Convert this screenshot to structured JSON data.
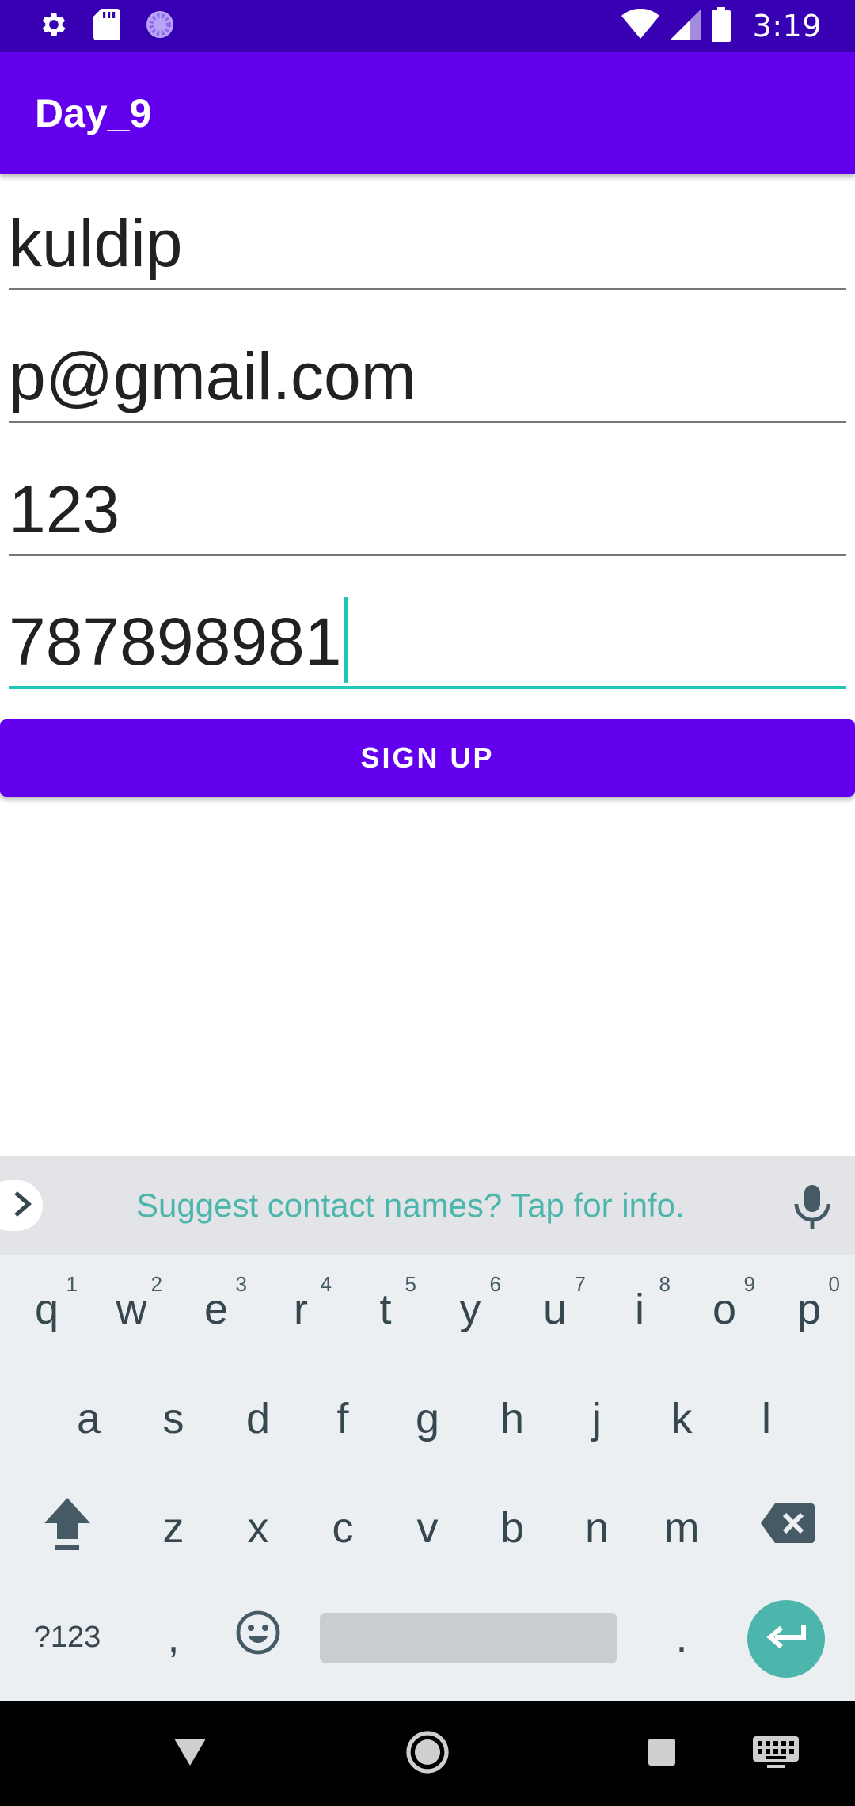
{
  "status_bar": {
    "time": "3:19",
    "left_icons": [
      "gear-icon",
      "sd-card-icon",
      "sync-icon"
    ],
    "right_icons": [
      "wifi-icon",
      "cell-signal-icon",
      "battery-icon"
    ]
  },
  "app_bar": {
    "title": "Day_9"
  },
  "form": {
    "name_value": "kuldip",
    "email_value": "p@gmail.com",
    "password_value": "123",
    "phone_value": "787898981",
    "signup_label": "SIGN UP"
  },
  "keyboard": {
    "suggestion": "Suggest contact names? Tap for info.",
    "row1": [
      {
        "key": "q",
        "hint": "1"
      },
      {
        "key": "w",
        "hint": "2"
      },
      {
        "key": "e",
        "hint": "3"
      },
      {
        "key": "r",
        "hint": "4"
      },
      {
        "key": "t",
        "hint": "5"
      },
      {
        "key": "y",
        "hint": "6"
      },
      {
        "key": "u",
        "hint": "7"
      },
      {
        "key": "i",
        "hint": "8"
      },
      {
        "key": "o",
        "hint": "9"
      },
      {
        "key": "p",
        "hint": "0"
      }
    ],
    "row2": [
      "a",
      "s",
      "d",
      "f",
      "g",
      "h",
      "j",
      "k",
      "l"
    ],
    "row3": [
      "z",
      "x",
      "c",
      "v",
      "b",
      "n",
      "m"
    ],
    "symbols_label": "?123",
    "comma": ",",
    "period": "."
  },
  "colors": {
    "status_bar": "#3700B3",
    "primary": "#6200EE",
    "accent": "#1FC7B8",
    "keyboard_accent": "#4DB6AC"
  }
}
